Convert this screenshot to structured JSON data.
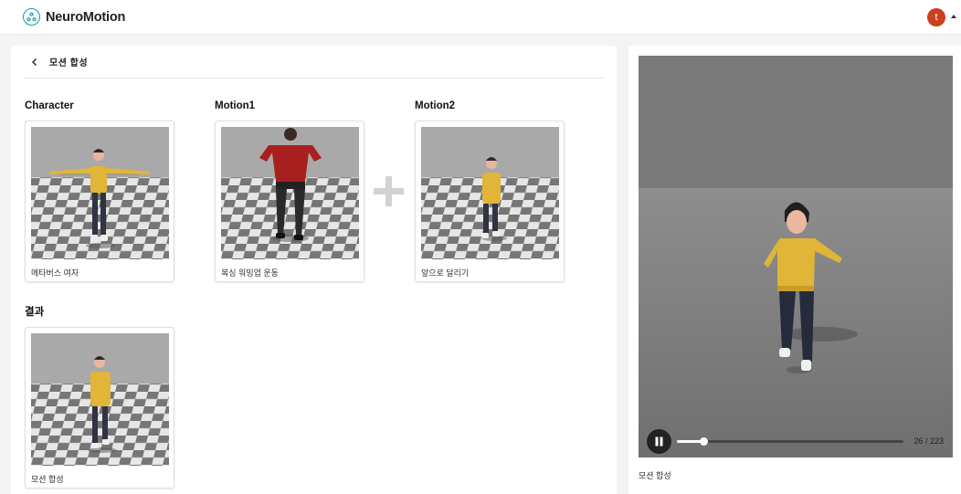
{
  "app": {
    "name": "NeuroMotion"
  },
  "user": {
    "initial": "t"
  },
  "page": {
    "title": "모션 합성"
  },
  "sections": {
    "character": "Character",
    "motion1": "Motion1",
    "motion2": "Motion2",
    "result": "결과"
  },
  "cards": {
    "character": {
      "caption": "메타버스 여자"
    },
    "motion1": {
      "caption": "복싱 워밍업 운동"
    },
    "motion2": {
      "caption": "앞으로 달리기"
    },
    "result": {
      "caption": "모션 합성"
    }
  },
  "player": {
    "frame": 26,
    "total": 223,
    "frame_label": "26 / 223",
    "caption": "모션 합성"
  },
  "colors": {
    "brand": "#0f9aa6",
    "avatar": "#c8401d",
    "viewport_bg": "#7c7c7c"
  },
  "icons": {
    "logo": "neuromotion-logo-icon",
    "back": "chevron-left-icon",
    "plus": "plus-icon",
    "pause": "pause-icon",
    "caret": "caret-up-icon"
  }
}
